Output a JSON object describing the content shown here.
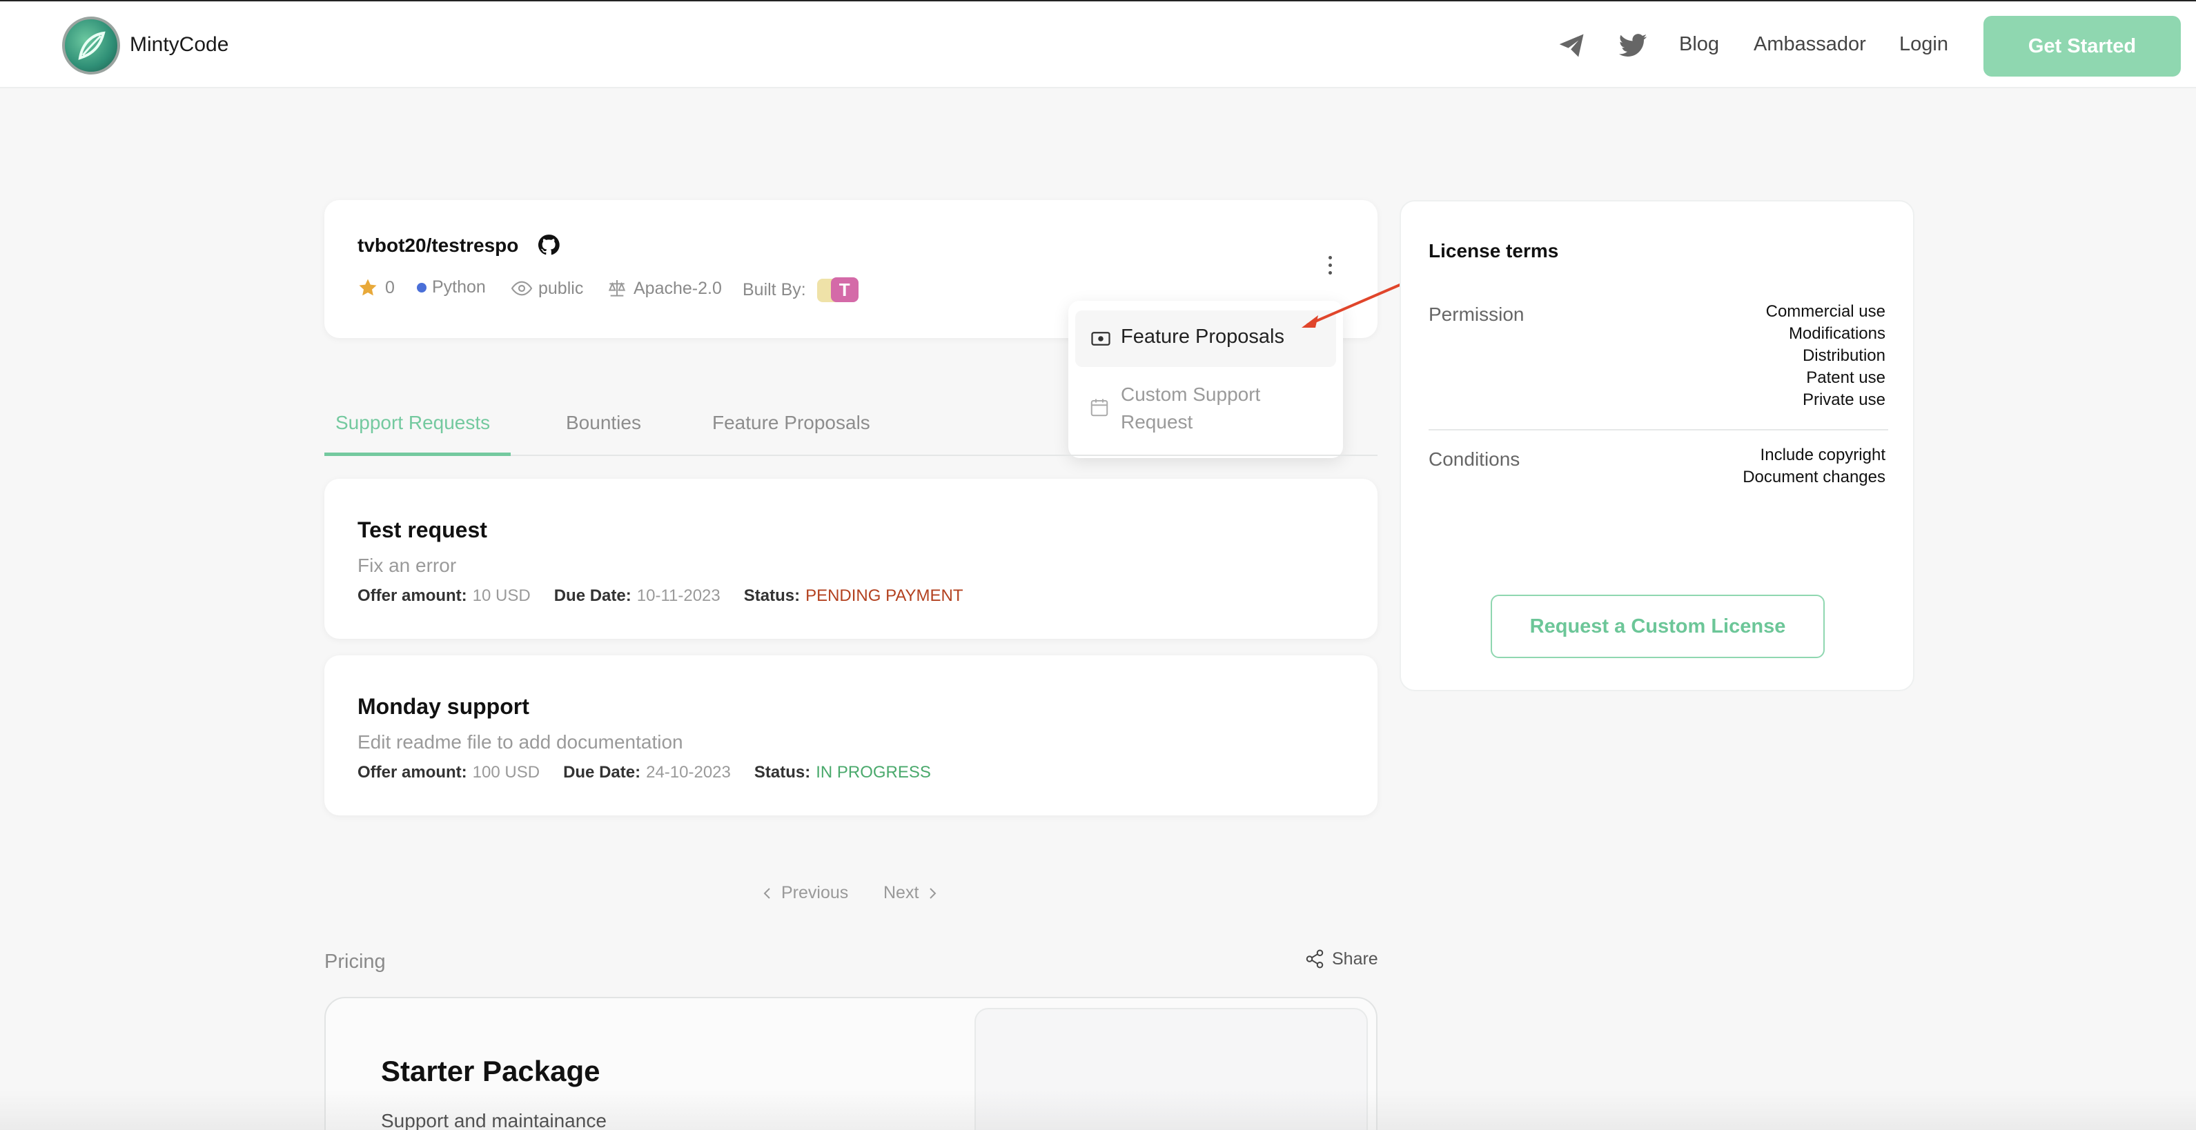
{
  "header": {
    "brand": "MintyCode",
    "nav": [
      "Blog",
      "Ambassador",
      "Login"
    ],
    "cta": "Get Started",
    "icons": [
      "telegram-icon",
      "twitter-icon"
    ]
  },
  "repo": {
    "name": "tvbot20/testrespo",
    "stars": "0",
    "language": "Python",
    "visibility": "public",
    "license": "Apache-2.0",
    "built_by_label": "Built By:"
  },
  "dropdown": {
    "items": [
      "Feature Proposals",
      "Custom Support Request"
    ]
  },
  "tabs": [
    "Support Requests",
    "Bounties",
    "Feature Proposals"
  ],
  "requests": [
    {
      "title": "Test request",
      "description": "Fix an error",
      "offer_label": "Offer amount:",
      "offer": "10 USD",
      "due_label": "Due Date:",
      "due": "10-11-2023",
      "status_label": "Status:",
      "status": "PENDING PAYMENT"
    },
    {
      "title": "Monday support",
      "description": "Edit readme file to add documentation",
      "offer_label": "Offer amount:",
      "offer": "100 USD",
      "due_label": "Due Date:",
      "due": "24-10-2023",
      "status_label": "Status:",
      "status": "IN PROGRESS"
    }
  ],
  "pagination": {
    "previous": "Previous",
    "next": "Next"
  },
  "pricing": {
    "label": "Pricing",
    "share": "Share",
    "package_title": "Starter Package",
    "package_subtitle": "Support and maintainance"
  },
  "license": {
    "title": "License terms",
    "permission_label": "Permission",
    "permissions": [
      "Commercial use",
      "Modifications",
      "Distribution",
      "Patent use",
      "Private use"
    ],
    "conditions_label": "Conditions",
    "conditions": [
      "Include copyright",
      "Document changes"
    ],
    "button": "Request a Custom License"
  },
  "colors": {
    "accent": "#74c99f",
    "cta": "#8fd7b0",
    "pending": "#b3411f",
    "in_progress": "#4aa96c",
    "arrow": "#e0452b"
  }
}
